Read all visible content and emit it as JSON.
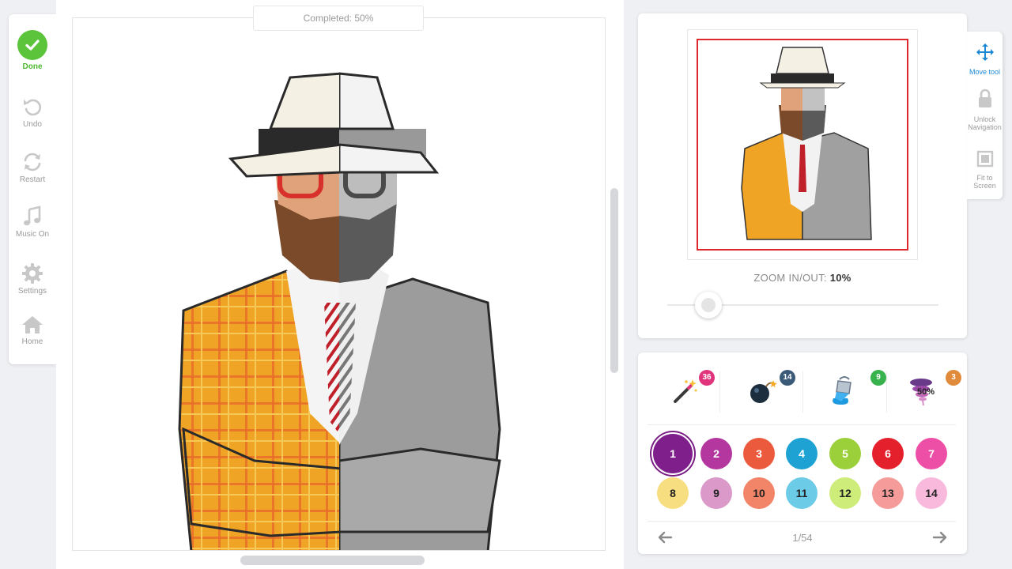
{
  "left_toolbar": {
    "done": "Done",
    "undo": "Undo",
    "restart": "Restart",
    "music": "Music On",
    "settings": "Settings",
    "home": "Home"
  },
  "canvas": {
    "progress_label": "Completed: 50%",
    "completion": 0.5,
    "artwork": "pixel-art man in white fedora, glasses, beard, plaid yellow jacket, half colored half grayscale"
  },
  "preview": {
    "zoom_label": "ZOOM IN/OUT:",
    "zoom_value": "10%",
    "zoom_level": 0.1
  },
  "nav_tools": {
    "move": "Move tool",
    "unlock": "Unlock Navigation",
    "fit": "Fit to Screen",
    "active_color": "#1e88d6"
  },
  "boosters": [
    {
      "icon": "magic-wand-icon",
      "count": "36",
      "badge_color": "#e0357c"
    },
    {
      "icon": "bomb-icon",
      "count": "14",
      "badge_color": "#3a5a78"
    },
    {
      "icon": "paint-bucket-icon",
      "count": "9",
      "badge_color": "#37b24d"
    },
    {
      "icon": "tornado-icon",
      "count": "3",
      "badge_color": "#e08a3c",
      "label": "50%"
    }
  ],
  "palette": {
    "page": "1/54",
    "colors": [
      {
        "num": "1",
        "color": "#7e1f8c",
        "selected": true
      },
      {
        "num": "2",
        "color": "#b3379e"
      },
      {
        "num": "3",
        "color": "#ec5a3e"
      },
      {
        "num": "4",
        "color": "#1ea2d4"
      },
      {
        "num": "5",
        "color": "#9bd03a"
      },
      {
        "num": "6",
        "color": "#e4202c"
      },
      {
        "num": "7",
        "color": "#ee4fa6"
      },
      {
        "num": "8",
        "color": "#f7de80"
      },
      {
        "num": "9",
        "color": "#da99c8"
      },
      {
        "num": "10",
        "color": "#f28467"
      },
      {
        "num": "11",
        "color": "#6ccce8"
      },
      {
        "num": "12",
        "color": "#cdec7a"
      },
      {
        "num": "13",
        "color": "#f59c9b"
      },
      {
        "num": "14",
        "color": "#f8b9dc"
      }
    ]
  }
}
